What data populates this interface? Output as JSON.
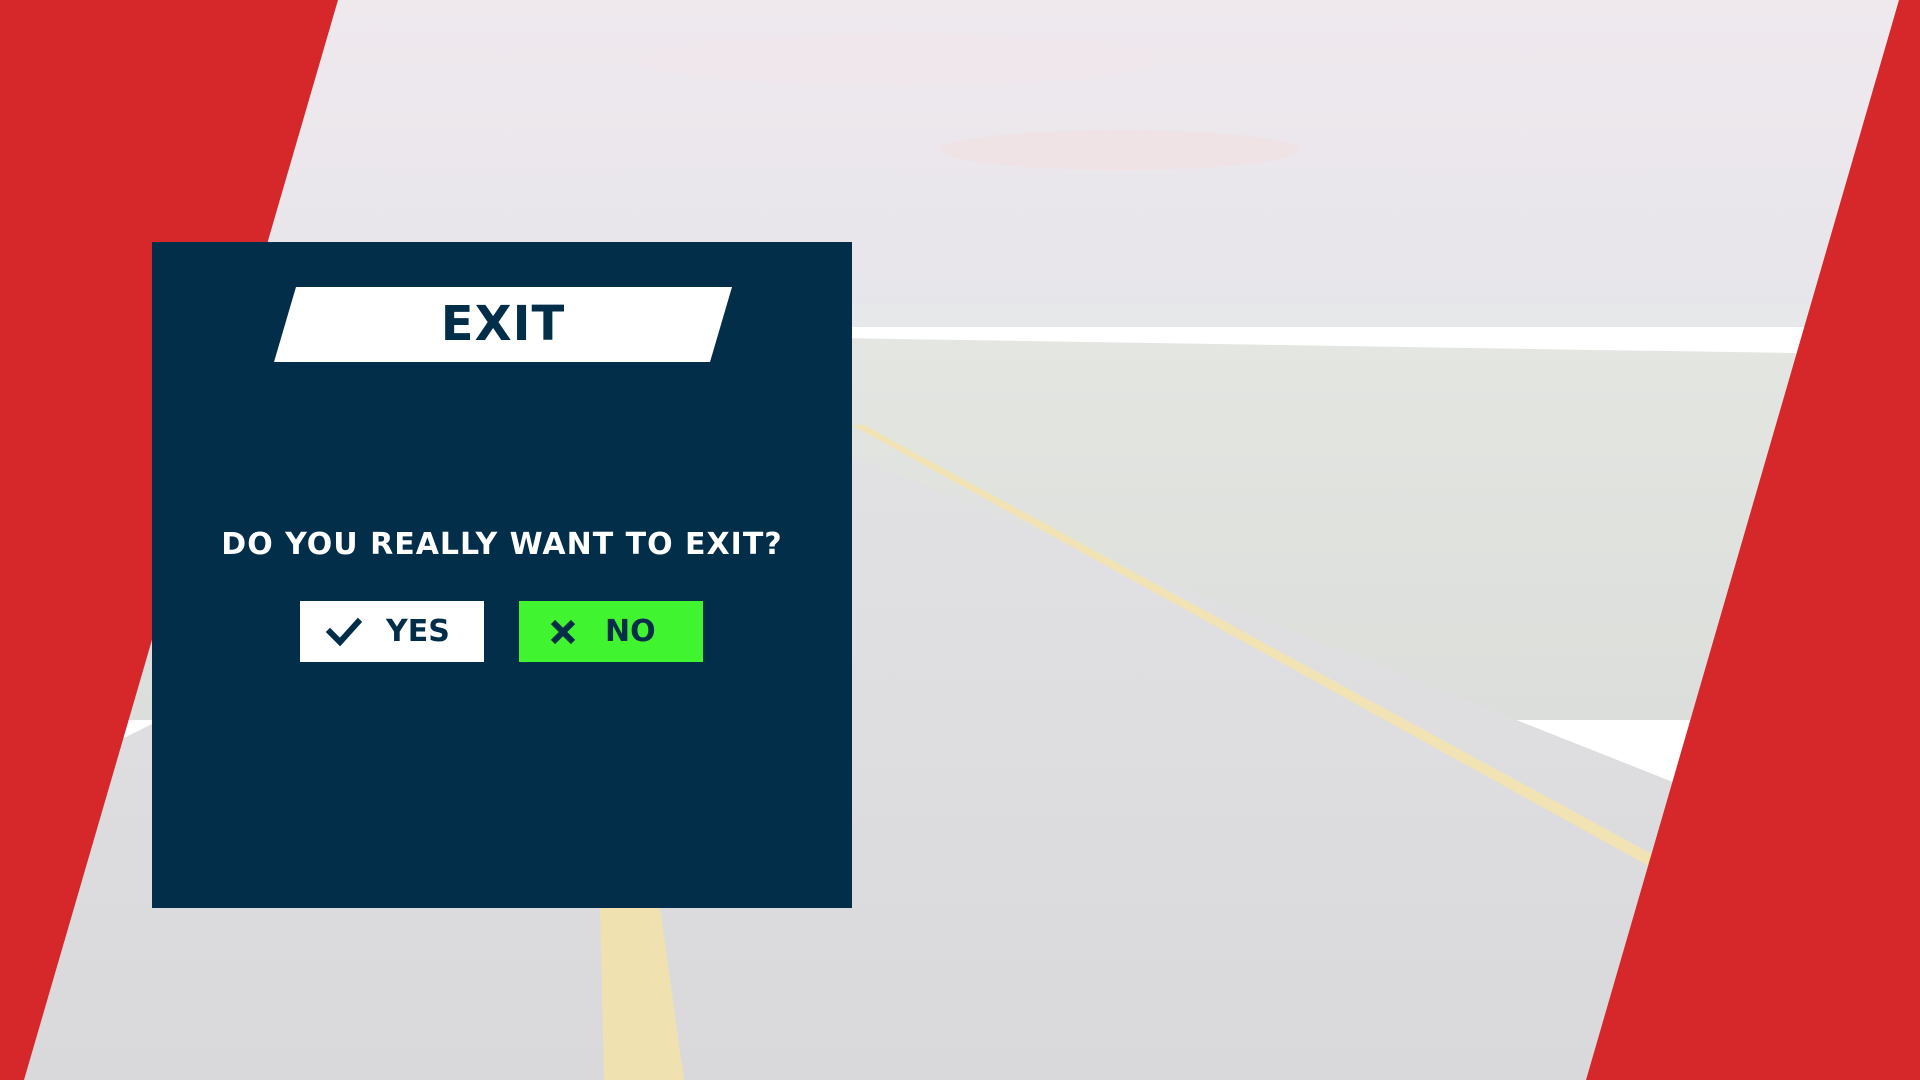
{
  "dialog": {
    "title": "EXIT",
    "question": "DO YOU REALLY WANT TO EXIT?",
    "yes_button": {
      "label": "YES",
      "icon": "checkmark-icon"
    },
    "no_button": {
      "label": "NO",
      "icon": "close-icon",
      "selected": true
    }
  },
  "colors": {
    "dialog_background": "#022e4a",
    "accent_red": "#d6282b",
    "selected_button": "#40f52f",
    "button_default": "#ffffff",
    "text_dark": "#022e4a",
    "text_light": "#ffffff"
  }
}
